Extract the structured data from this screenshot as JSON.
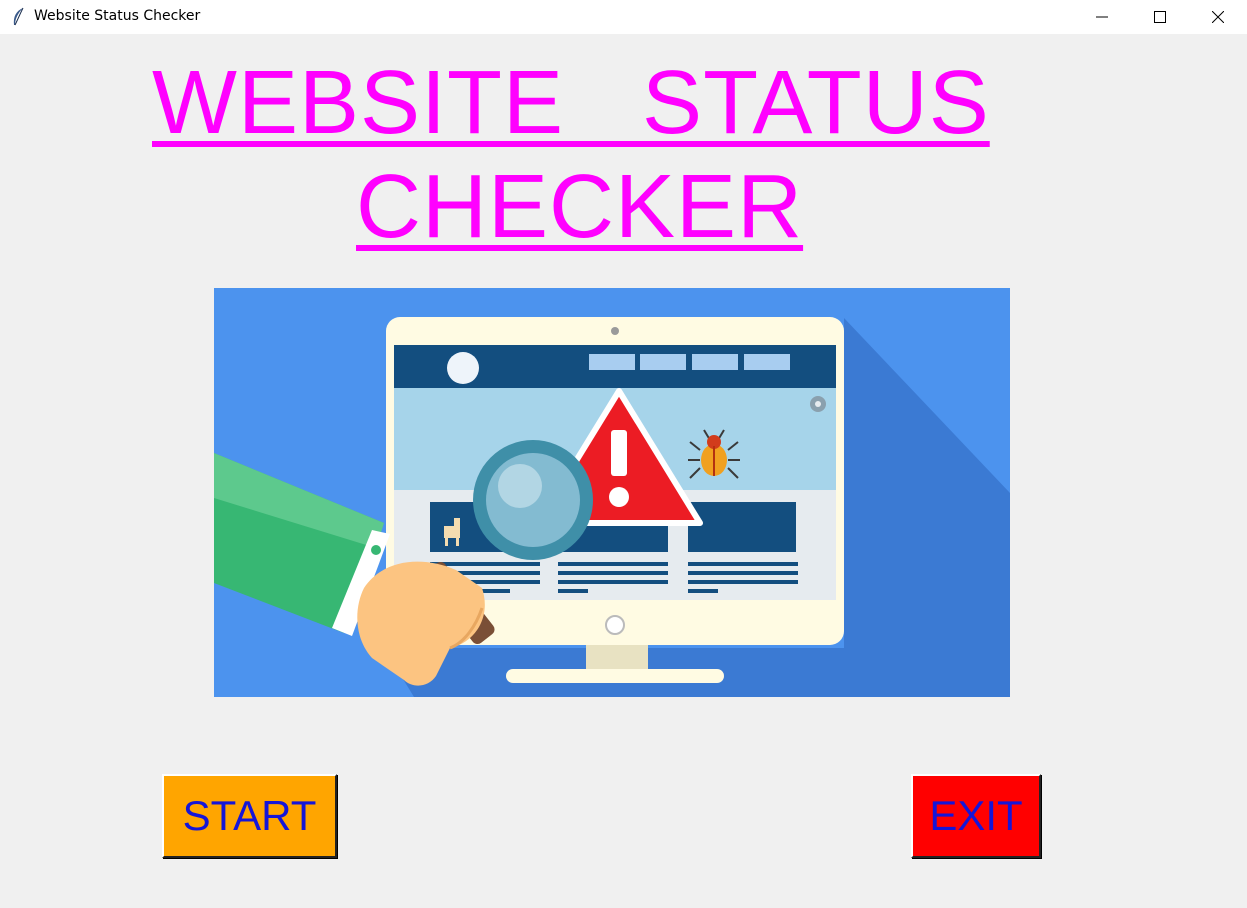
{
  "window": {
    "title": "Website Status Checker",
    "icon": "feather-icon",
    "controls": [
      "minimize-icon",
      "maximize-icon",
      "close-icon"
    ]
  },
  "main": {
    "heading_line1": "WEBSITE   STATUS",
    "heading_line2": "CHECKER",
    "heading_color": "#ff00ff",
    "illustration": "website-scan-illustration",
    "start_label": "START",
    "exit_label": "EXIT",
    "start_color": "#ffa500",
    "exit_color": "#ff0000",
    "button_text_color": "#1515d8"
  }
}
